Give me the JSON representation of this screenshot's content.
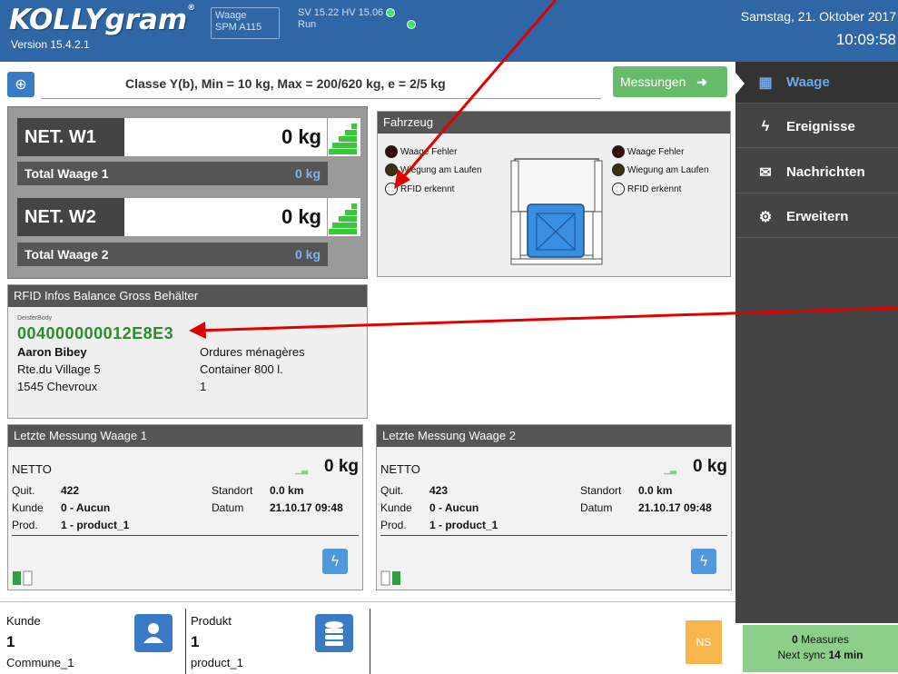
{
  "header": {
    "logo": "KOLLYgram",
    "logo_mark": "®",
    "version": "Version 15.4.2.1",
    "status_line1": "Waage",
    "status_line2": "SPM A115",
    "sv_line1": "SV 15.22  HV  15.06",
    "sv_line2": "Run",
    "date": "Samstag, 21. Oktober 2017",
    "time": "10:09:58"
  },
  "topbar": {
    "class_text": "Classe Y(b), Min = 10 kg, Max = 200/620 kg, e = 2/5 kg",
    "messungen_label": "Messungen"
  },
  "sidebar": {
    "items": [
      {
        "label": "Waage",
        "icon": "scale-icon"
      },
      {
        "label": "Ereignisse",
        "icon": "bolt-icon"
      },
      {
        "label": "Nachrichten",
        "icon": "envelope-icon"
      },
      {
        "label": "Erweitern",
        "icon": "gears-icon"
      }
    ]
  },
  "scales": {
    "w1_label": "NET. W1",
    "w1_value": "0 kg",
    "total1_label": "Total Waage 1",
    "total1_value": "0 kg",
    "w2_label": "NET. W2",
    "w2_value": "0 kg",
    "total2_label": "Total Waage 2",
    "total2_value": "0 kg"
  },
  "fahrzeug": {
    "title": "Fahrzeug",
    "left": [
      "Waage Fehler",
      "Wiegung am Laufen",
      "RFID erkennt"
    ],
    "right": [
      "Waage Fehler",
      "Wiegung am Laufen",
      "RFID erkennt"
    ]
  },
  "rfid": {
    "title": "RFID Infos Balance Gross Behälter",
    "source": "DeisterBody",
    "tag": "004000000012E8E3",
    "name": "Aaron Bibey",
    "street": "Rte.du Village 5",
    "city": "1545 Chevroux",
    "waste": "Ordures ménagères",
    "container": "Container 800 l.",
    "count": "1"
  },
  "mess1": {
    "title": "Letzte Messung Waage 1",
    "netto": "NETTO",
    "value": "0 kg",
    "quit_label": "Quit.",
    "quit": "422",
    "kunde_label": "Kunde",
    "kunde": "0 - Aucun",
    "prod_label": "Prod.",
    "prod": "1 - product_1",
    "standort_label": "Standort",
    "standort": "0.0 km",
    "datum_label": "Datum",
    "datum": "21.10.17 09:48"
  },
  "mess2": {
    "title": "Letzte Messung Waage 2",
    "netto": "NETTO",
    "value": "0 kg",
    "quit_label": "Quit.",
    "quit": "423",
    "kunde_label": "Kunde",
    "kunde": "0 - Aucun",
    "prod_label": "Prod.",
    "prod": "1 - product_1",
    "standort_label": "Standort",
    "standort": "0.0 km",
    "datum_label": "Datum",
    "datum": "21.10.17 09:48"
  },
  "bottom": {
    "kunde_label": "Kunde",
    "kunde_value": "1",
    "kunde_sub": "Commune_1",
    "produkt_label": "Produkt",
    "produkt_value": "1",
    "produkt_sub": "product_1",
    "ns_label": "NS",
    "measures_count": "0",
    "measures_label": "Measures",
    "sync_label": "Next sync",
    "sync_value": "14 min"
  },
  "colors": {
    "header_blue": "#2e66a6",
    "accent_green": "#66bb6a",
    "tag_green": "#2d8a2d",
    "sidebar": "#444444",
    "annotation_red": "#e00000"
  }
}
